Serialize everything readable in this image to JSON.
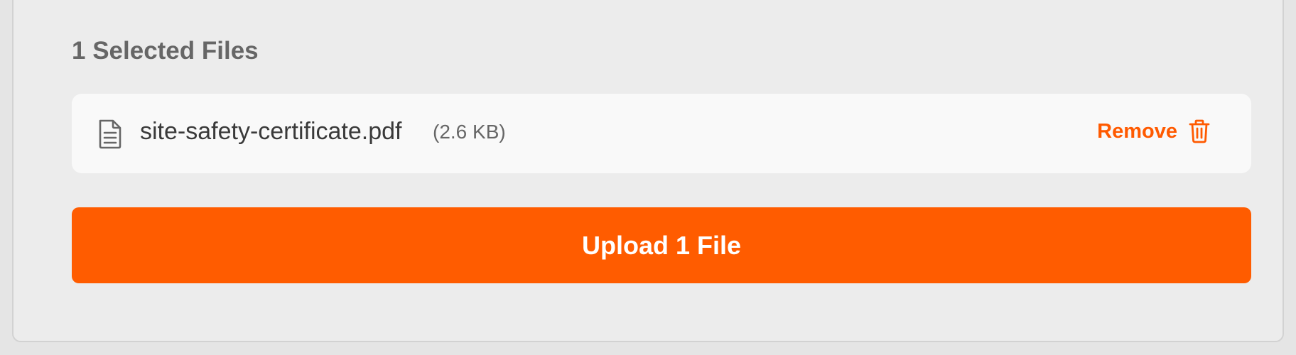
{
  "selected_files": {
    "heading": "1 Selected Files",
    "files": [
      {
        "name": "site-safety-certificate.pdf",
        "size": "(2.6 KB)",
        "icon": "file-text-icon",
        "remove_label": "Remove",
        "remove_icon": "trash-icon"
      }
    ]
  },
  "upload_button": {
    "label": "Upload 1 File"
  },
  "colors": {
    "accent": "#ff5c00",
    "remove_text": "#ff5a00",
    "panel_bg": "#ececec",
    "row_bg": "#f9f9f9"
  }
}
